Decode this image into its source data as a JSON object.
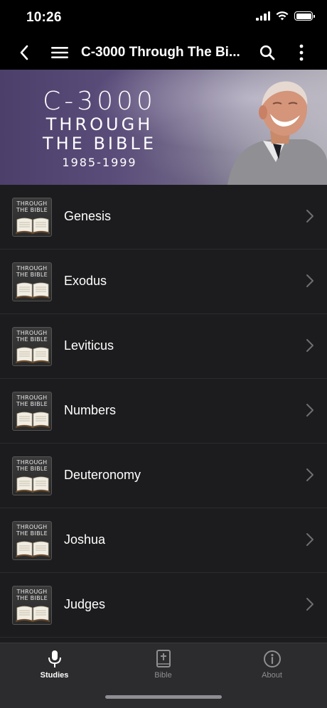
{
  "status_bar": {
    "time": "10:26"
  },
  "nav": {
    "title": "C-3000 Through The Bi...",
    "icons": [
      "back-icon",
      "hamburger-menu-icon",
      "search-icon",
      "more-vertical-icon"
    ]
  },
  "banner": {
    "line1": "C-3000",
    "line2": "THROUGH",
    "line3": "THE BIBLE",
    "line4": "1985-1999"
  },
  "thumbnail": {
    "label_line1": "THROUGH",
    "label_line2": "THE BIBLE"
  },
  "list": {
    "items": [
      {
        "label": "Genesis"
      },
      {
        "label": "Exodus"
      },
      {
        "label": "Leviticus"
      },
      {
        "label": "Numbers"
      },
      {
        "label": "Deuteronomy"
      },
      {
        "label": "Joshua"
      },
      {
        "label": "Judges"
      }
    ]
  },
  "tabs": [
    {
      "label": "Studies",
      "icon": "microphone-icon",
      "active": true
    },
    {
      "label": "Bible",
      "icon": "bible-cross-icon",
      "active": false
    },
    {
      "label": "About",
      "icon": "info-icon",
      "active": false
    }
  ],
  "colors": {
    "background": "#000000",
    "list_background": "#1c1c1e",
    "tab_bar": "#2c2c2e",
    "inactive_tab": "#8e8e93"
  }
}
